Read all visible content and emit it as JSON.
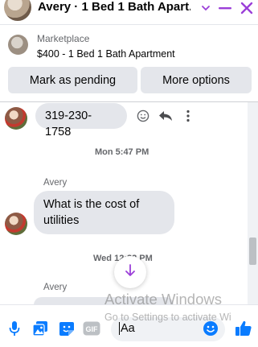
{
  "header": {
    "title": "Avery · 1 Bed 1 Bath Apart...",
    "chevron_icon": "chevron-down-icon",
    "minimize_icon": "minimize-icon",
    "close_icon": "close-icon",
    "accent_color": "#9b3fd8"
  },
  "listing": {
    "label": "Marketplace",
    "title": "$400 - 1 Bed 1 Bath Apartment"
  },
  "actions": {
    "mark_pending": "Mark as pending",
    "more_options": "More options"
  },
  "messages": [
    {
      "text": "319-230-1758",
      "icons": [
        "emoji-react-icon",
        "reply-icon",
        "more-vert-icon"
      ]
    },
    {
      "timestamp": "Mon 5:47 PM",
      "sender": "Avery",
      "text": "What is the cost of utilities"
    },
    {
      "timestamp": "Wed 12:32 PM",
      "sender": "Avery"
    }
  ],
  "composer": {
    "placeholder": "Aa",
    "icons": [
      "microphone-icon",
      "photo-icon",
      "sticker-icon",
      "gif-icon",
      "emoji-icon",
      "thumbs-up-icon"
    ],
    "icon_color": "#0a7cff"
  },
  "watermark": {
    "title": "Activate Windows",
    "subtitle": "Go to Settings to activate Wi"
  }
}
